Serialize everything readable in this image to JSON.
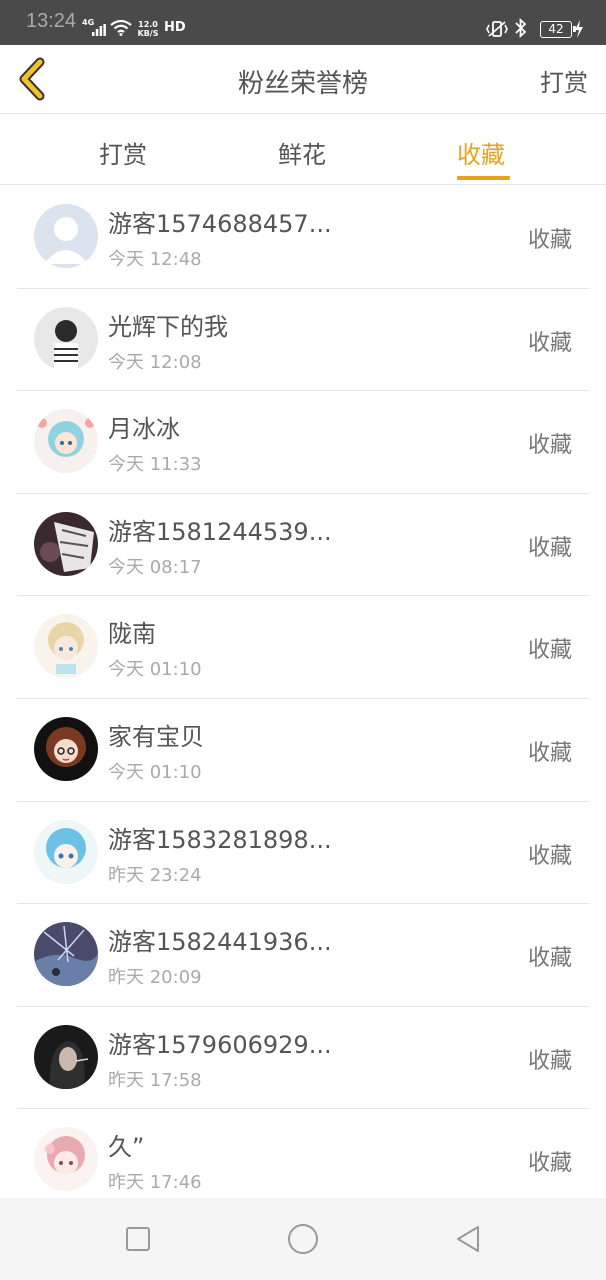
{
  "status_bar": {
    "time": "13:24",
    "network": "4G",
    "speed_top": "12.0",
    "speed_bottom": "KB/S",
    "hd": "HD",
    "battery": "42"
  },
  "header": {
    "title": "粉丝荣誉榜",
    "action_label": "打赏"
  },
  "tabs": [
    {
      "label": "打赏",
      "active": false
    },
    {
      "label": "鲜花",
      "active": false
    },
    {
      "label": "收藏",
      "active": true
    }
  ],
  "accent_color": "#e8a21f",
  "list": [
    {
      "name": "游客1574688457...",
      "time": "今天 12:48",
      "action": "收藏"
    },
    {
      "name": "光辉下的我",
      "time": "今天 12:08",
      "action": "收藏"
    },
    {
      "name": "月冰冰",
      "time": "今天 11:33",
      "action": "收藏"
    },
    {
      "name": "游客1581244539...",
      "time": "今天 08:17",
      "action": "收藏"
    },
    {
      "name": "陇南",
      "time": "今天 01:10",
      "action": "收藏"
    },
    {
      "name": "家有宝贝",
      "time": "今天 01:10",
      "action": "收藏"
    },
    {
      "name": "游客1583281898...",
      "time": "昨天 23:24",
      "action": "收藏"
    },
    {
      "name": "游客1582441936...",
      "time": "昨天 20:09",
      "action": "收藏"
    },
    {
      "name": "游客1579606929...",
      "time": "昨天 17:58",
      "action": "收藏"
    },
    {
      "name": "久”",
      "time": "昨天 17:46",
      "action": "收藏"
    }
  ],
  "icons": {
    "back": "chevron-left-icon",
    "home": "circle-home-icon",
    "recents": "square-recents-icon",
    "nav_back": "triangle-back-icon"
  }
}
